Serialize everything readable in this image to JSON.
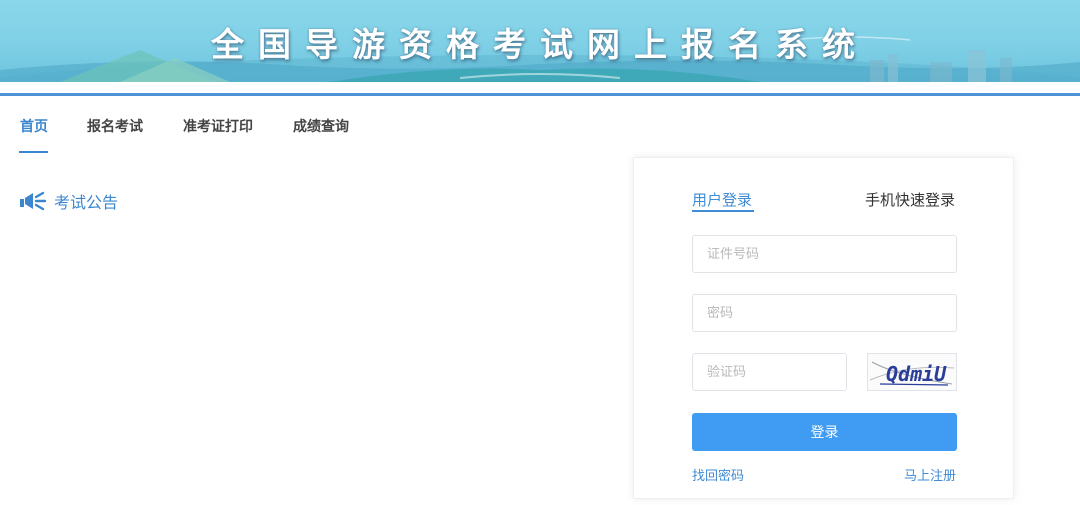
{
  "banner": {
    "title": "全国导游资格考试网上报名系统"
  },
  "nav": {
    "items": [
      {
        "label": "首页",
        "active": true
      },
      {
        "label": "报名考试",
        "active": false
      },
      {
        "label": "准考证打印",
        "active": false
      },
      {
        "label": "成绩查询",
        "active": false
      }
    ]
  },
  "notice": {
    "icon": "megaphone-icon",
    "title": "考试公告"
  },
  "login": {
    "tabs": [
      {
        "label": "用户登录",
        "active": true
      },
      {
        "label": "手机快速登录",
        "active": false
      }
    ],
    "id_placeholder": "证件号码",
    "password_placeholder": "密码",
    "captcha_placeholder": "验证码",
    "captcha_text": "QdmiU",
    "login_label": "登录",
    "forgot_label": "找回密码",
    "register_label": "马上注册"
  },
  "colors": {
    "accent": "#3c86cf",
    "button": "#409cf3",
    "banner": "#7fd0e6"
  }
}
